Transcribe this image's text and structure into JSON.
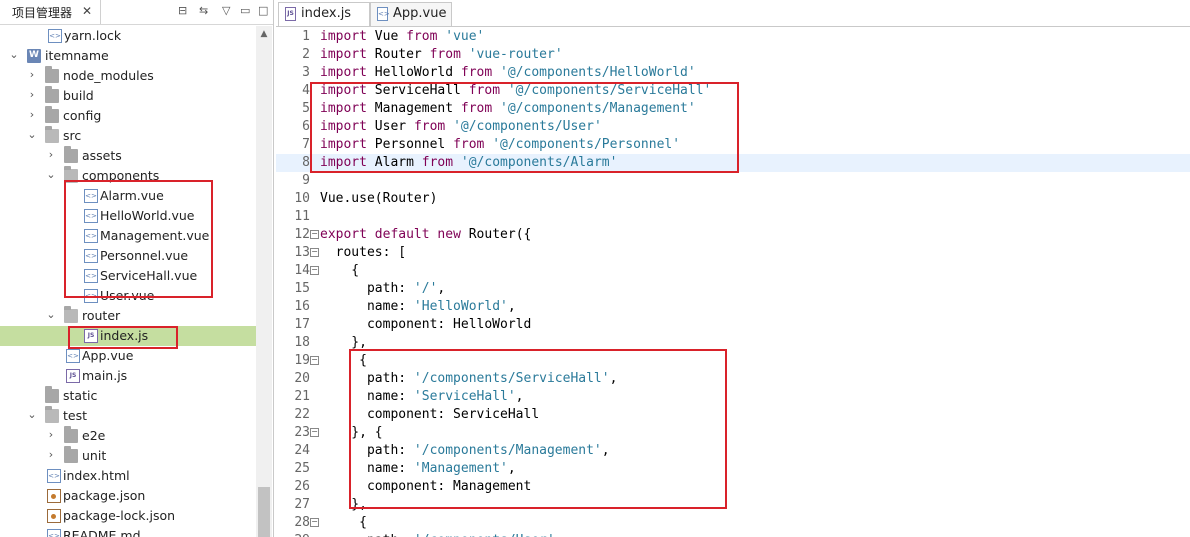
{
  "explorer": {
    "tab_label": "项目管理器",
    "close_glyph": "✕",
    "toolbar": {
      "collapse": "⊟",
      "link": "⇆",
      "menu": "▽",
      "minimize": "▭",
      "maximize": "□"
    },
    "items": [
      {
        "label": "yarn.lock",
        "icon": "file-icon"
      },
      {
        "label": "itemname",
        "icon": "project-icon",
        "expanded": true
      },
      {
        "label": "node_modules",
        "icon": "library-folder-icon",
        "expanded": false
      },
      {
        "label": "build",
        "icon": "folder-icon",
        "expanded": false
      },
      {
        "label": "config",
        "icon": "folder-icon",
        "expanded": false
      },
      {
        "label": "src",
        "icon": "folder-icon",
        "expanded": true
      },
      {
        "label": "assets",
        "icon": "folder-icon",
        "expanded": false
      },
      {
        "label": "components",
        "icon": "folder-icon",
        "expanded": true
      },
      {
        "label": "Alarm.vue",
        "icon": "vue-file-icon"
      },
      {
        "label": "HelloWorld.vue",
        "icon": "vue-file-icon"
      },
      {
        "label": "Management.vue",
        "icon": "vue-file-icon"
      },
      {
        "label": "Personnel.vue",
        "icon": "vue-file-icon"
      },
      {
        "label": "ServiceHall.vue",
        "icon": "vue-file-icon"
      },
      {
        "label": "User.vue",
        "icon": "vue-file-icon"
      },
      {
        "label": "router",
        "icon": "folder-icon",
        "expanded": true
      },
      {
        "label": "index.js",
        "icon": "js-file-icon",
        "selected": true
      },
      {
        "label": "App.vue",
        "icon": "vue-file-icon"
      },
      {
        "label": "main.js",
        "icon": "js-file-icon"
      },
      {
        "label": "static",
        "icon": "folder-icon"
      },
      {
        "label": "test",
        "icon": "folder-icon",
        "expanded": true
      },
      {
        "label": "e2e",
        "icon": "folder-icon",
        "expanded": false
      },
      {
        "label": "unit",
        "icon": "folder-icon",
        "expanded": false
      },
      {
        "label": "index.html",
        "icon": "html-file-icon"
      },
      {
        "label": "package.json",
        "icon": "json-file-icon"
      },
      {
        "label": "package-lock.json",
        "icon": "json-file-icon"
      },
      {
        "label": "README.md",
        "icon": "md-file-icon"
      }
    ],
    "selected_color": "#c5dea0"
  },
  "editor": {
    "tabs": [
      {
        "label": "index.js",
        "icon": "js-file-icon",
        "active": true
      },
      {
        "label": "App.vue",
        "icon": "vue-file-icon",
        "active": false
      }
    ],
    "current_line": 8,
    "lines": [
      {
        "n": "1",
        "segs": [
          [
            "kw",
            "import"
          ],
          [
            "t",
            " Vue "
          ],
          [
            "kw",
            "from"
          ],
          [
            "t",
            " "
          ],
          [
            "str",
            "'vue'"
          ]
        ]
      },
      {
        "n": "2",
        "segs": [
          [
            "kw",
            "import"
          ],
          [
            "t",
            " Router "
          ],
          [
            "kw",
            "from"
          ],
          [
            "t",
            " "
          ],
          [
            "str",
            "'vue-router'"
          ]
        ]
      },
      {
        "n": "3",
        "segs": [
          [
            "kw",
            "import"
          ],
          [
            "t",
            " HelloWorld "
          ],
          [
            "kw",
            "from"
          ],
          [
            "t",
            " "
          ],
          [
            "str",
            "'@/components/HelloWorld'"
          ]
        ]
      },
      {
        "n": "4",
        "segs": [
          [
            "kw",
            "import"
          ],
          [
            "t",
            " ServiceHall "
          ],
          [
            "kw",
            "from"
          ],
          [
            "t",
            " "
          ],
          [
            "str",
            "'@/components/ServiceHall'"
          ]
        ]
      },
      {
        "n": "5",
        "segs": [
          [
            "kw",
            "import"
          ],
          [
            "t",
            " Management "
          ],
          [
            "kw",
            "from"
          ],
          [
            "t",
            " "
          ],
          [
            "str",
            "'@/components/Management'"
          ]
        ]
      },
      {
        "n": "6",
        "segs": [
          [
            "kw",
            "import"
          ],
          [
            "t",
            " User "
          ],
          [
            "kw",
            "from"
          ],
          [
            "t",
            " "
          ],
          [
            "str",
            "'@/components/User'"
          ]
        ]
      },
      {
        "n": "7",
        "segs": [
          [
            "kw",
            "import"
          ],
          [
            "t",
            " Personnel "
          ],
          [
            "kw",
            "from"
          ],
          [
            "t",
            " "
          ],
          [
            "str",
            "'@/components/Personnel'"
          ]
        ]
      },
      {
        "n": "8",
        "segs": [
          [
            "kw",
            "import"
          ],
          [
            "t",
            " Alarm "
          ],
          [
            "kw",
            "from"
          ],
          [
            "t",
            " "
          ],
          [
            "str",
            "'@/components/Alarm'"
          ]
        ]
      },
      {
        "n": "9",
        "segs": []
      },
      {
        "n": "10",
        "segs": [
          [
            "t",
            "Vue.use(Router)"
          ]
        ]
      },
      {
        "n": "11",
        "segs": []
      },
      {
        "n": "12",
        "fold": true,
        "segs": [
          [
            "kw",
            "export"
          ],
          [
            "t",
            " "
          ],
          [
            "kw",
            "default"
          ],
          [
            "t",
            " "
          ],
          [
            "kw",
            "new"
          ],
          [
            "t",
            " Router({"
          ]
        ]
      },
      {
        "n": "13",
        "fold": true,
        "segs": [
          [
            "t",
            "  routes: ["
          ]
        ]
      },
      {
        "n": "14",
        "fold": true,
        "segs": [
          [
            "t",
            "    {"
          ]
        ]
      },
      {
        "n": "15",
        "segs": [
          [
            "t",
            "      path: "
          ],
          [
            "str",
            "'/'"
          ],
          [
            "t",
            ","
          ]
        ]
      },
      {
        "n": "16",
        "segs": [
          [
            "t",
            "      name: "
          ],
          [
            "str",
            "'HelloWorld'"
          ],
          [
            "t",
            ","
          ]
        ]
      },
      {
        "n": "17",
        "segs": [
          [
            "t",
            "      component: HelloWorld"
          ]
        ]
      },
      {
        "n": "18",
        "segs": [
          [
            "t",
            "    },"
          ]
        ]
      },
      {
        "n": "19",
        "fold": true,
        "segs": [
          [
            "t",
            "     {"
          ]
        ]
      },
      {
        "n": "20",
        "segs": [
          [
            "t",
            "      path: "
          ],
          [
            "str",
            "'/components/ServiceHall'"
          ],
          [
            "t",
            ","
          ]
        ]
      },
      {
        "n": "21",
        "segs": [
          [
            "t",
            "      name: "
          ],
          [
            "str",
            "'ServiceHall'"
          ],
          [
            "t",
            ","
          ]
        ]
      },
      {
        "n": "22",
        "segs": [
          [
            "t",
            "      component: ServiceHall"
          ]
        ]
      },
      {
        "n": "23",
        "fold": true,
        "segs": [
          [
            "t",
            "    }, {"
          ]
        ]
      },
      {
        "n": "24",
        "segs": [
          [
            "t",
            "      path: "
          ],
          [
            "str",
            "'/components/Management'"
          ],
          [
            "t",
            ","
          ]
        ]
      },
      {
        "n": "25",
        "segs": [
          [
            "t",
            "      name: "
          ],
          [
            "str",
            "'Management'"
          ],
          [
            "t",
            ","
          ]
        ]
      },
      {
        "n": "26",
        "segs": [
          [
            "t",
            "      component: Management"
          ]
        ]
      },
      {
        "n": "27",
        "segs": [
          [
            "t",
            "    },"
          ]
        ]
      },
      {
        "n": "28",
        "fold": true,
        "segs": [
          [
            "t",
            "     {"
          ]
        ]
      },
      {
        "n": "29",
        "segs": [
          [
            "t",
            "      path: "
          ],
          [
            "str",
            "'/components/User'"
          ],
          [
            "t",
            ","
          ]
        ]
      }
    ]
  },
  "annotations": {
    "box_color": "#d9222a"
  }
}
